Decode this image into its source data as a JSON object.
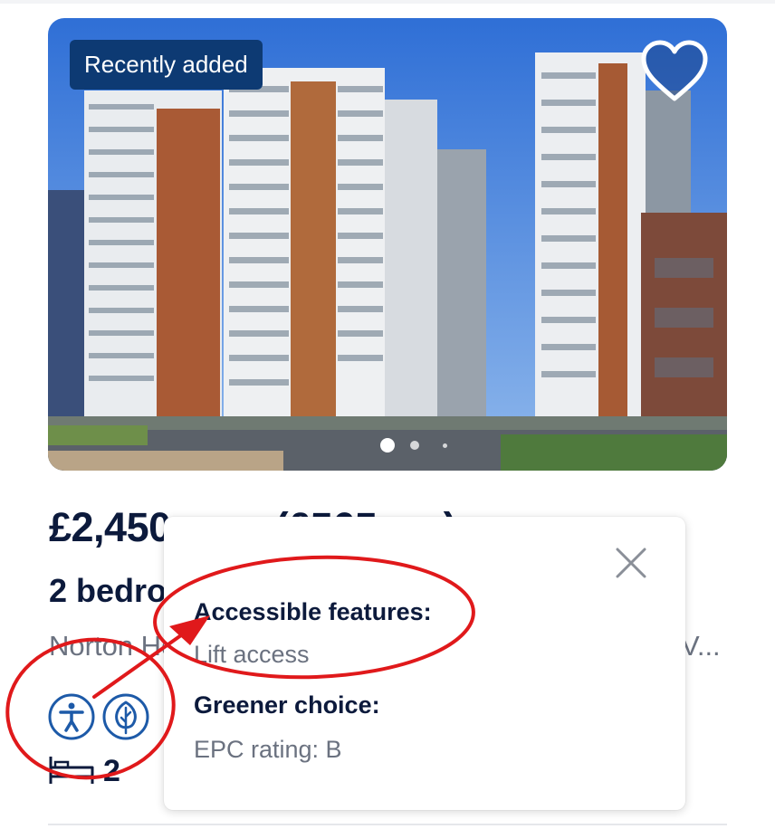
{
  "listing": {
    "badge": "Recently added",
    "price": "£2,450 pcm (£565 pw)",
    "title": "2 bedroom flat to rent",
    "address": "Norton House, Royal Wharf, London, E16",
    "address_suffix": "V...",
    "bedrooms": "2"
  },
  "carousel": {
    "slide_count": 3,
    "active_index": 0
  },
  "popover": {
    "section_1_heading": "Accessible features:",
    "section_1_value": "Lift access",
    "section_2_heading": "Greener choice:",
    "section_2_value": "EPC rating: B"
  },
  "icons": {
    "favourite": "heart-icon",
    "accessibility": "accessibility-icon",
    "green": "leaf-icon",
    "bed": "bed-icon",
    "close": "close-icon"
  },
  "colors": {
    "brand_navy": "#0d3a73",
    "icon_blue": "#1d5aa8",
    "annotation_red": "#e0191b",
    "text_dark": "#0c1a3c",
    "text_muted": "#6b7280"
  }
}
